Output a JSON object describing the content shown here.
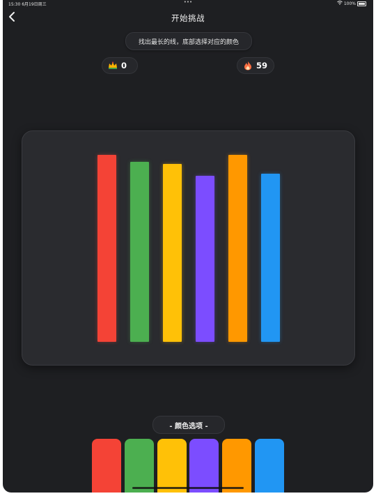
{
  "status_bar": {
    "time": "15:30",
    "date": "6月19日周三",
    "dots": "•••",
    "battery": "100%"
  },
  "header": {
    "back_icon": "chevron-left-icon",
    "title": "开始挑战"
  },
  "instruction": "找出最长的线，底部选择对应的颜色",
  "stats": {
    "score": {
      "icon": "crown-icon",
      "value": "0"
    },
    "timer": {
      "icon": "flame-icon",
      "value": "59"
    }
  },
  "lines": [
    {
      "color": "#f44336",
      "length": 0.8
    },
    {
      "color": "#4caf50",
      "length": 0.77
    },
    {
      "color": "#ffc107",
      "length": 0.76
    },
    {
      "color": "#7c4dff",
      "length": 0.71
    },
    {
      "color": "#ff9800",
      "length": 0.8
    },
    {
      "color": "#2196f3",
      "length": 0.72
    }
  ],
  "options_label": "- 颜色选项 -",
  "options": [
    {
      "color": "#f44336"
    },
    {
      "color": "#4caf50"
    },
    {
      "color": "#ffc107"
    },
    {
      "color": "#7c4dff"
    },
    {
      "color": "#ff9800"
    },
    {
      "color": "#2196f3"
    }
  ]
}
